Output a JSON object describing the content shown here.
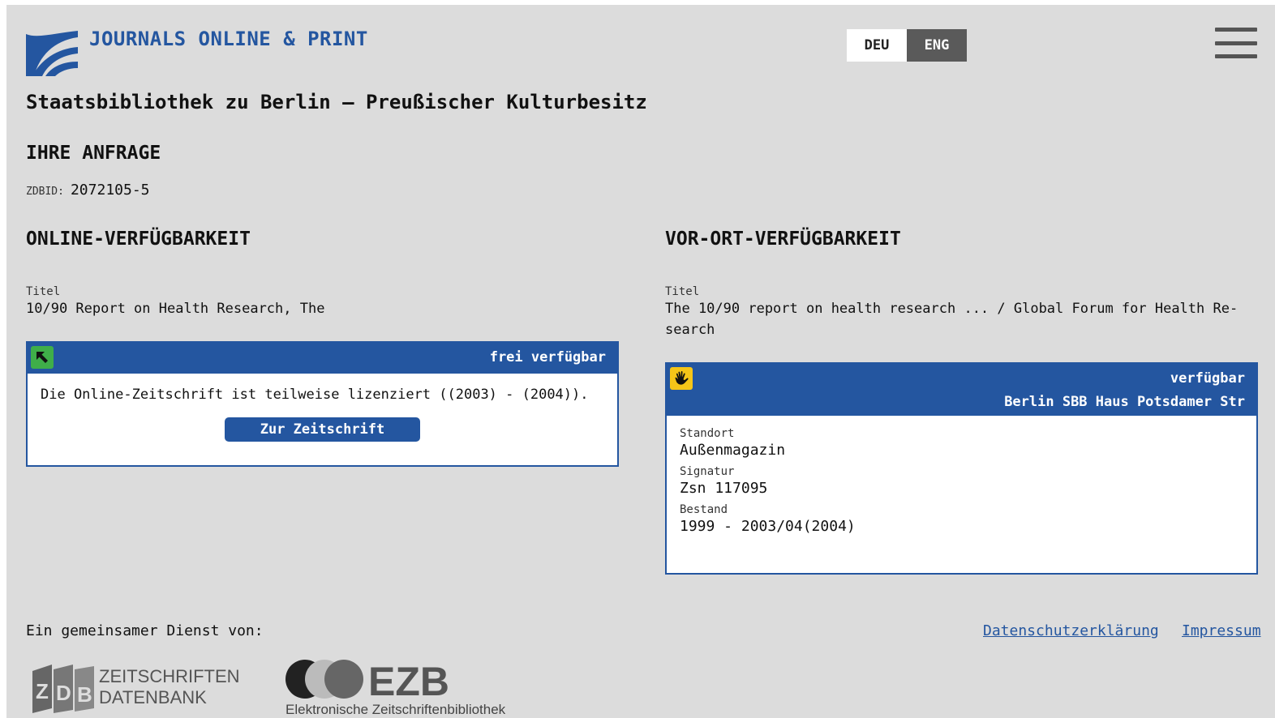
{
  "header": {
    "brand": "JOURNALS ONLINE & PRINT",
    "institution": "Staatsbibliothek zu Berlin – Preußischer Kulturbesitz",
    "lang": {
      "deu": "DEU",
      "eng": "ENG",
      "active": "ENG"
    },
    "menu_icon": "hamburger-menu-icon"
  },
  "query": {
    "heading": "IHRE ANFRAGE",
    "zdbid_label": "ZDBID:",
    "zdbid_value": "2072105-5"
  },
  "online": {
    "heading": "ONLINE-VERFÜGBARKEIT",
    "title_label": "Titel",
    "title_value": "10/90 Report on Health Research, The",
    "status": "frei verfügbar",
    "status_icon": "arrow-up-left-icon",
    "status_color": "#3fae49",
    "license_text": "Die Online-Zeitschrift ist teilweise lizenziert ((2003) - (2004)).",
    "button": "Zur Zeitschrift"
  },
  "vorort": {
    "heading": "VOR-ORT-VERFÜGBARKEIT",
    "title_label": "Titel",
    "title_line1": "The 10/90 report on health research ... / Global Forum for Health Re-",
    "title_line2": "search",
    "status": "verfügbar",
    "location": "Berlin SBB Haus Potsdamer Str",
    "status_icon": "hand-icon",
    "status_color": "#f5c518",
    "standort_label": "Standort",
    "standort_value": "Außenmagazin",
    "signatur_label": "Signatur",
    "signatur_value": "Zsn 117095",
    "bestand_label": "Bestand",
    "bestand_value": "1999 - 2003/04(2004)"
  },
  "footer": {
    "service_label": "Ein gemeinsamer Dienst von:",
    "privacy": "Datenschutzerklärung",
    "imprint": "Impressum",
    "zdb_line1": "ZEITSCHRIFTEN",
    "zdb_line2": "DATENBANK",
    "ezb_subtitle": "Elektronische Zeitschriftenbibliothek"
  },
  "colors": {
    "accent": "#2456a0",
    "background": "#dcdcdc"
  }
}
